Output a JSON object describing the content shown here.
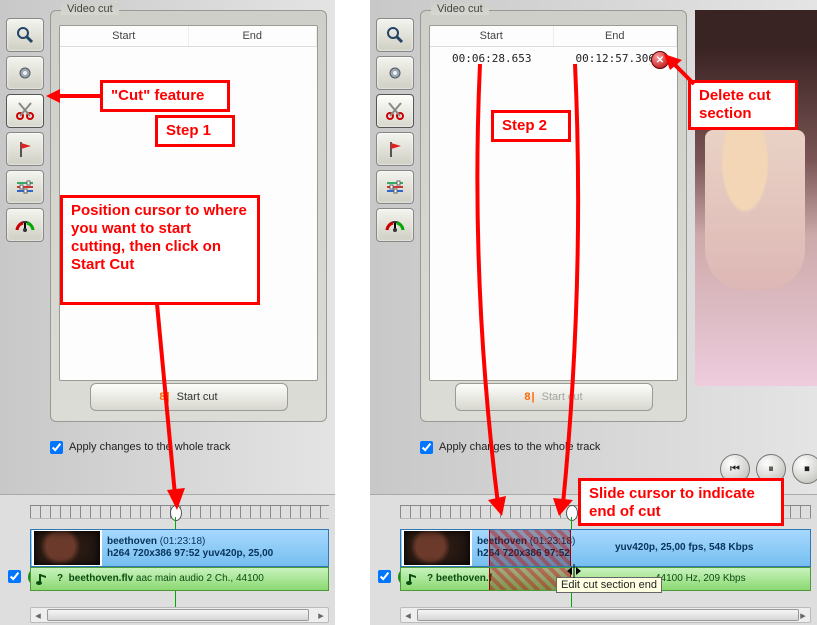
{
  "panel": {
    "title": "Video cut"
  },
  "columns": {
    "start": "Start",
    "end": "End"
  },
  "cut_row": {
    "start": "00:06:28.653",
    "end": "00:12:57.306"
  },
  "start_cut_btn": "Start cut",
  "apply_label": "Apply changes to the whole track",
  "video_track": {
    "name": "beethoven",
    "duration": "(01:23:18)",
    "spec_left": "h264 720x386 97:52 yuv420p, 25,00",
    "spec_right": "yuv420p, 25,00 fps, 548 Kbps"
  },
  "audio_track": {
    "name": "beethoven.flv",
    "spec_left": "aac main audio 2 Ch., 44100",
    "spec_right": "44100 Hz, 209 Kbps"
  },
  "tooltip": "Edit cut section end",
  "right_audio_prefix": "? ",
  "transport": {
    "prev": "⏮",
    "pause": "⏸",
    "stop": "⏹"
  },
  "annotations": {
    "cut_feature": "\"Cut\" feature",
    "step1": "Step 1",
    "step2": "Step 2",
    "position": "Position cursor to where you want to start cutting, then click on Start Cut",
    "delete": "Delete cut section",
    "slide": "Slide cursor to indicate end of cut"
  },
  "icons": {
    "zoom": "zoom-icon",
    "gear": "gear-icon",
    "scissors": "scissors-icon",
    "flag": "flag-icon",
    "sliders": "sliders-icon",
    "gauge": "gauge-icon"
  }
}
